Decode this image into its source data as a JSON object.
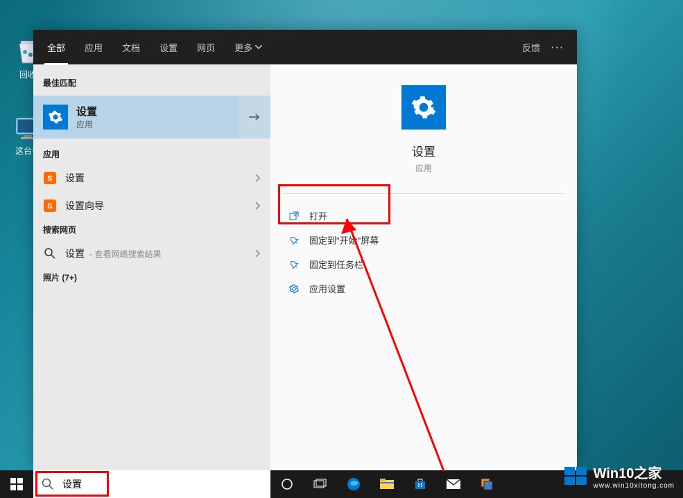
{
  "desktop": {
    "recycle_bin": "回收",
    "this_pc": "这台电"
  },
  "search": {
    "input_value": "设置"
  },
  "panel": {
    "tabs": {
      "all": "全部",
      "apps": "应用",
      "docs": "文档",
      "settings": "设置",
      "web": "网页",
      "more": "更多"
    },
    "feedback": "反馈",
    "sections": {
      "best_match": "最佳匹配",
      "apps": "应用",
      "web": "搜索网页",
      "photos": "照片 (7+)"
    },
    "best": {
      "title": "设置",
      "sub": "应用"
    },
    "apps_list": {
      "item1": "设置",
      "item2": "设置向导"
    },
    "web_item": {
      "title": "设置",
      "sub": " - 查看网络搜索结果"
    },
    "detail": {
      "title": "设置",
      "sub": "应用",
      "actions": {
        "open": "打开",
        "pin_start": "固定到\"开始\"屏幕",
        "pin_taskbar": "固定到任务栏",
        "app_settings": "应用设置"
      }
    }
  },
  "watermark": {
    "title": "Win10之家",
    "url": "www.win10xitong.com"
  }
}
